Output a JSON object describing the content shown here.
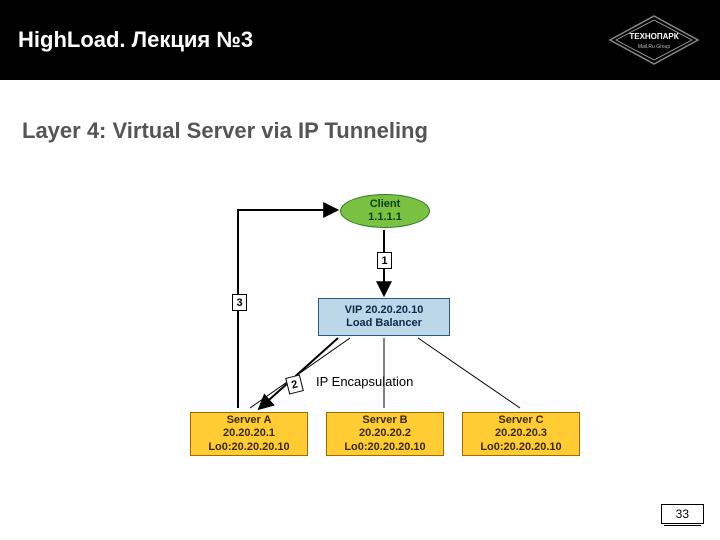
{
  "header": {
    "title": "HighLoad. Лекция №3",
    "logo_top": "ТЕХНОПАРК",
    "logo_sub": "Mail.Ru Group"
  },
  "subtitle": "Layer 4: Virtual Server via IP Tunneling",
  "diagram": {
    "client": {
      "name": "Client",
      "ip": "1.1.1.1"
    },
    "vip": {
      "label": "VIP 20.20.20.10",
      "role": "Load Balancer"
    },
    "servers": {
      "a": {
        "name": "Server A",
        "ip": "20.20.20.1",
        "lo": "Lo0:20.20.20.10"
      },
      "b": {
        "name": "Server B",
        "ip": "20.20.20.2",
        "lo": "Lo0:20.20.20.10"
      },
      "c": {
        "name": "Server C",
        "ip": "20.20.20.3",
        "lo": "Lo0:20.20.20.10"
      }
    },
    "steps": {
      "s1": "1",
      "s2": "2",
      "s3": "3"
    },
    "encapsulation_label": "IP Encapsulation"
  },
  "page_number": "33"
}
